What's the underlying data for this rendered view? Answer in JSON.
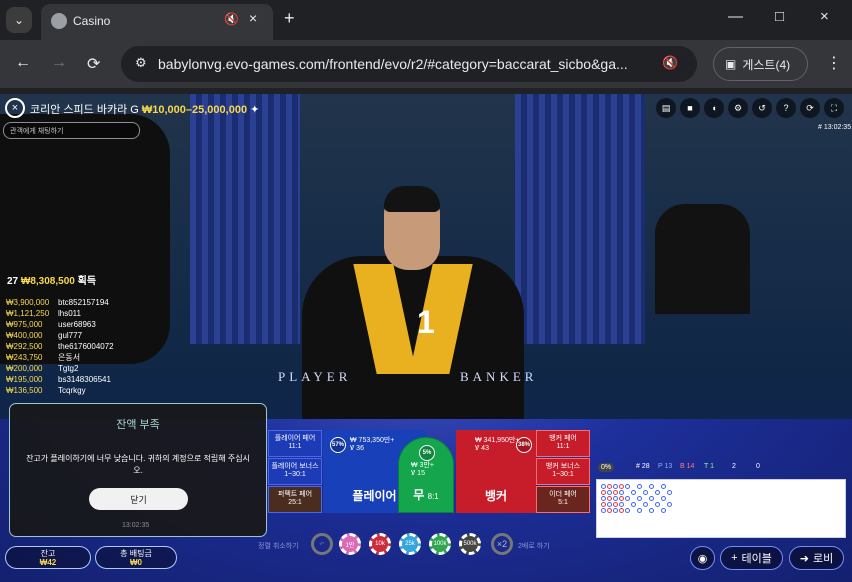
{
  "browser": {
    "tab_title": "Casino",
    "url": "babylonvg.evo-games.com/frontend/evo/r2/#category=baccarat_sicbo&ga...",
    "guest_label": "게스트(4)",
    "icons": {
      "tab_list": "chevron-down-icon",
      "favicon": "globe-icon",
      "mute": "speaker-muted-icon",
      "close": "close-icon",
      "new_tab": "plus-icon",
      "minimize": "minimize-icon",
      "maximize": "maximize-icon",
      "window_close": "close-icon",
      "back": "arrow-left-icon",
      "forward": "arrow-right-icon",
      "reload": "reload-icon",
      "site_info": "tune-icon",
      "guest": "person-icon",
      "menu": "more-vert-icon"
    }
  },
  "game": {
    "title": "코리안 스피드 바카라 G",
    "limits": "₩10,000–25,000,000",
    "chat_placeholder": "관객에게 채팅하기",
    "round_id": "# 13:02:35",
    "count": "1",
    "table_player": "PLAYER",
    "table_banker": "BANKER",
    "top_icons": [
      "chat-icon",
      "video-icon",
      "speaker-icon",
      "settings-icon",
      "history-icon",
      "help-icon",
      "refresh-icon",
      "fullscreen-icon"
    ]
  },
  "winners": {
    "summary_count": "27",
    "summary_amount": "₩8,308,500",
    "summary_label": "획득",
    "rows": [
      {
        "amount": "₩3,900,000",
        "name": "btc852157194"
      },
      {
        "amount": "₩1,121,250",
        "name": "lhs011"
      },
      {
        "amount": "₩975,000",
        "name": "user68963"
      },
      {
        "amount": "₩400,000",
        "name": "gul777"
      },
      {
        "amount": "₩292,500",
        "name": "the6176004072"
      },
      {
        "amount": "₩243,750",
        "name": "은동서"
      },
      {
        "amount": "₩200,000",
        "name": "Tgtg2"
      },
      {
        "amount": "₩195,000",
        "name": "bs3148306541"
      },
      {
        "amount": "₩136,500",
        "name": "Tcqrkgy"
      }
    ]
  },
  "modal": {
    "title": "잔액 부족",
    "body": "잔고가 플레이하기에 너무 낮습니다. 귀하의 계정으로 적립해 주십시오.",
    "close_label": "닫기",
    "time": "13:02:35"
  },
  "bets": {
    "player_pair": {
      "label": "플레이어 페어",
      "odds": "11:1"
    },
    "player_bonus": {
      "label": "플레이어 보너스",
      "odds": "1~30:1"
    },
    "perfect_pair": {
      "label": "퍼펙트 페어",
      "odds": "25:1"
    },
    "player": {
      "label": "플레이어",
      "total": "₩ 753,350만+",
      "count": "Ꝟ 36",
      "percent": "57%"
    },
    "tie": {
      "label": "무",
      "odds": "8:1",
      "total": "₩ 3만+",
      "count": "Ꝟ 15",
      "percent": "5%"
    },
    "banker": {
      "label": "뱅커",
      "total": "₩ 341,950만+",
      "count": "Ꝟ 43",
      "percent": "38%"
    },
    "banker_pair": {
      "label": "뱅커 페어",
      "odds": "11:1"
    },
    "banker_bonus": {
      "label": "뱅커 보너스",
      "odds": "1~30:1"
    },
    "either_pair": {
      "label": "이더 페어",
      "odds": "5:1"
    }
  },
  "chips": {
    "left_text": "정렬 취소하기",
    "right_text": "2배로 하기",
    "values": [
      "1만",
      "10k",
      "25k",
      "100k",
      "500k"
    ],
    "double": "×2"
  },
  "balance": {
    "label": "잔고",
    "value": "₩42"
  },
  "total_bet": {
    "label": "총 배팅금",
    "value": "₩0"
  },
  "roadmap": {
    "percent": "0%",
    "round_count": "# 28",
    "player": "P 13",
    "banker": "B 14",
    "tie": "T 1",
    "player_pair": "2",
    "banker_pair": "0"
  },
  "bottom_buttons": {
    "table": "테이블",
    "lobby": "로비"
  },
  "colors": {
    "accent_gold": "#f8d84f",
    "player_blue": "#1840b8",
    "banker_red": "#c71c2a",
    "tie_green": "#14a54d"
  }
}
